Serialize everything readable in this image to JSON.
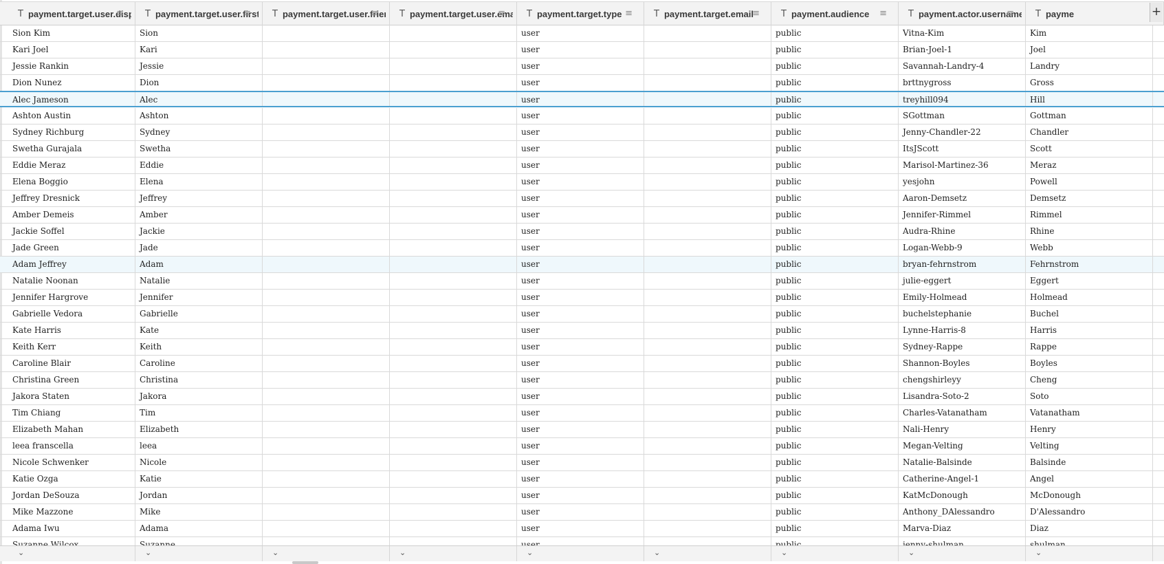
{
  "columns": [
    {
      "label": "payment.target.user.display_n",
      "type_icon": "T",
      "menu_icon": "≡"
    },
    {
      "label": "payment.target.user.first_nam",
      "type_icon": "T",
      "menu_icon": "≡"
    },
    {
      "label": "payment.target.user.friend_sta",
      "type_icon": "T",
      "menu_icon": "≡"
    },
    {
      "label": "payment.target.user.email",
      "type_icon": "T",
      "menu_icon": "≡"
    },
    {
      "label": "payment.target.type",
      "type_icon": "T",
      "menu_icon": "≡"
    },
    {
      "label": "payment.target.email",
      "type_icon": "T",
      "menu_icon": "≡"
    },
    {
      "label": "payment.audience",
      "type_icon": "T",
      "menu_icon": "≡"
    },
    {
      "label": "payment.actor.username",
      "type_icon": "T",
      "menu_icon": "≡"
    },
    {
      "label": "payme",
      "type_icon": "T",
      "menu_icon": ""
    }
  ],
  "add_column_label": "+",
  "footer_chevron": "⌄",
  "selected_rows": [
    4,
    14
  ],
  "active_row": 4,
  "rows": [
    [
      "Sion Kim",
      "Sion",
      "",
      "",
      "user",
      "",
      "public",
      "Vitna-Kim",
      "Kim"
    ],
    [
      "Kari Joel",
      "Kari",
      "",
      "",
      "user",
      "",
      "public",
      "Brian-Joel-1",
      "Joel"
    ],
    [
      "Jessie Rankin",
      "Jessie",
      "",
      "",
      "user",
      "",
      "public",
      "Savannah-Landry-4",
      "Landry"
    ],
    [
      "Dion Nunez",
      "Dion",
      "",
      "",
      "user",
      "",
      "public",
      "brttnygross",
      "Gross"
    ],
    [
      "Alec Jameson",
      "Alec",
      "",
      "",
      "user",
      "",
      "public",
      "treyhill094",
      "Hill"
    ],
    [
      "Ashton Austin",
      "Ashton",
      "",
      "",
      "user",
      "",
      "public",
      "SGottman",
      "Gottman"
    ],
    [
      "Sydney Richburg",
      "Sydney",
      "",
      "",
      "user",
      "",
      "public",
      "Jenny-Chandler-22",
      "Chandler"
    ],
    [
      "Swetha Gurajala",
      "Swetha",
      "",
      "",
      "user",
      "",
      "public",
      "ItsJScott",
      "Scott"
    ],
    [
      "Eddie Meraz",
      "Eddie",
      "",
      "",
      "user",
      "",
      "public",
      "Marisol-Martinez-36",
      "Meraz"
    ],
    [
      "Elena Boggio",
      "Elena",
      "",
      "",
      "user",
      "",
      "public",
      "yesjohn",
      "Powell"
    ],
    [
      "Jeffrey Dresnick",
      "Jeffrey",
      "",
      "",
      "user",
      "",
      "public",
      "Aaron-Demsetz",
      "Demsetz"
    ],
    [
      "Amber Demeis",
      "Amber",
      "",
      "",
      "user",
      "",
      "public",
      "Jennifer-Rimmel",
      "Rimmel"
    ],
    [
      "Jackie Soffel",
      "Jackie",
      "",
      "",
      "user",
      "",
      "public",
      "Audra-Rhine",
      "Rhine"
    ],
    [
      "Jade Green",
      "Jade",
      "",
      "",
      "user",
      "",
      "public",
      "Logan-Webb-9",
      "Webb"
    ],
    [
      "Adam Jeffrey",
      "Adam",
      "",
      "",
      "user",
      "",
      "public",
      "bryan-fehrnstrom",
      "Fehrnstrom"
    ],
    [
      "Natalie Noonan",
      "Natalie",
      "",
      "",
      "user",
      "",
      "public",
      "julie-eggert",
      "Eggert"
    ],
    [
      "Jennifer Hargrove",
      "Jennifer",
      "",
      "",
      "user",
      "",
      "public",
      "Emily-Holmead",
      "Holmead"
    ],
    [
      "Gabrielle Vedora",
      "Gabrielle",
      "",
      "",
      "user",
      "",
      "public",
      "buchelstephanie",
      "Buchel"
    ],
    [
      "Kate Harris",
      "Kate",
      "",
      "",
      "user",
      "",
      "public",
      "Lynne-Harris-8",
      "Harris"
    ],
    [
      "Keith Kerr",
      "Keith",
      "",
      "",
      "user",
      "",
      "public",
      "Sydney-Rappe",
      "Rappe"
    ],
    [
      "Caroline Blair",
      "Caroline",
      "",
      "",
      "user",
      "",
      "public",
      "Shannon-Boyles",
      "Boyles"
    ],
    [
      "Christina Green",
      "Christina",
      "",
      "",
      "user",
      "",
      "public",
      "chengshirleyy",
      "Cheng"
    ],
    [
      "Jakora Staten",
      "Jakora",
      "",
      "",
      "user",
      "",
      "public",
      "Lisandra-Soto-2",
      "Soto"
    ],
    [
      "Tim Chiang",
      "Tim",
      "",
      "",
      "user",
      "",
      "public",
      "Charles-Vatanatham",
      "Vatanatham"
    ],
    [
      "Elizabeth Mahan",
      "Elizabeth",
      "",
      "",
      "user",
      "",
      "public",
      "Nali-Henry",
      "Henry"
    ],
    [
      "leea franscella",
      "leea",
      "",
      "",
      "user",
      "",
      "public",
      "Megan-Velting",
      "Velting"
    ],
    [
      "Nicole Schwenker",
      "Nicole",
      "",
      "",
      "user",
      "",
      "public",
      "Natalie-Balsinde",
      "Balsinde"
    ],
    [
      "Katie Ozga",
      "Katie",
      "",
      "",
      "user",
      "",
      "public",
      "Catherine-Angel-1",
      "Angel"
    ],
    [
      "Jordan DeSouza",
      "Jordan",
      "",
      "",
      "user",
      "",
      "public",
      "KatMcDonough",
      "McDonough"
    ],
    [
      "Mike Mazzone",
      "Mike",
      "",
      "",
      "user",
      "",
      "public",
      "Anthony_DAlessandro",
      "D'Alessandro"
    ],
    [
      "Adama Iwu",
      "Adama",
      "",
      "",
      "user",
      "",
      "public",
      "Marva-Diaz",
      "Diaz"
    ],
    [
      "Suzanne Wilcox",
      "Suzanne",
      "",
      "",
      "user",
      "",
      "public",
      "jenny-shulman",
      "shulman"
    ]
  ]
}
